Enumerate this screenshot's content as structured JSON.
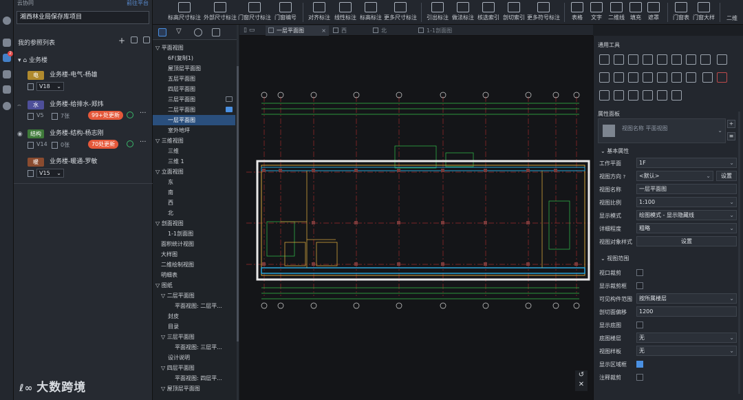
{
  "colors": {
    "accent": "#4a90e2",
    "update_badge": "#e5583a",
    "tag_elec": "#b08a2e",
    "tag_water": "#4e4f9a",
    "tag_struct": "#3f7a3a",
    "tag_hvac": "#8a4b2f"
  },
  "left": {
    "header": "云协同",
    "header_right": "前往平台",
    "project": "湘西林业局保存库项目",
    "section_title": "我的参照列表",
    "tree_root": "业务楼",
    "refs": [
      {
        "tag": "电",
        "name": "业务楼-电气-杨雄",
        "version": "V18",
        "count": "",
        "update": ""
      },
      {
        "tag": "水",
        "name": "业务楼-给排水-郑炜",
        "version": "V5",
        "count": "7张",
        "update": "99+处更新"
      },
      {
        "tag": "结构",
        "name": "业务楼-结构-杨志刚",
        "version": "V14",
        "count": "0张",
        "update": "70处更新"
      },
      {
        "tag": "暖",
        "name": "业务楼-暖通-罗敏",
        "version": "V15",
        "count": "",
        "update": ""
      }
    ],
    "watermark": "大数跨境"
  },
  "toolbar": {
    "items": [
      "标高尺寸标注",
      "外部尺寸标注",
      "门窗尺寸标注",
      "门窗编号",
      "对齐标注",
      "线性标注",
      "标高标注",
      "更多尺寸标注",
      "引出标注",
      "做法标注",
      "核选索引",
      "剖切索引",
      "更多符号标注",
      "表格",
      "文字",
      "二维线",
      "填充",
      "遮罩",
      "门窗表",
      "门窗大样",
      "二维"
    ]
  },
  "browser": {
    "items": [
      {
        "t": "▽ 平面视图",
        "lvl": 0
      },
      {
        "t": "6F(复制1)",
        "lvl": 2
      },
      {
        "t": "屋顶层平面图",
        "lvl": 2
      },
      {
        "t": "五层平面图",
        "lvl": 2
      },
      {
        "t": "四层平面图",
        "lvl": 2
      },
      {
        "t": "三层平面图",
        "lvl": 2
      },
      {
        "t": "二层平面图",
        "lvl": 2
      },
      {
        "t": "一层平面图",
        "lvl": 2
      },
      {
        "t": "室外地坪",
        "lvl": 2
      },
      {
        "t": "▽ 三维视图",
        "lvl": 0
      },
      {
        "t": "三维",
        "lvl": 2
      },
      {
        "t": "三维 1",
        "lvl": 2
      },
      {
        "t": "▽ 立面视图",
        "lvl": 0
      },
      {
        "t": "东",
        "lvl": 2
      },
      {
        "t": "南",
        "lvl": 2
      },
      {
        "t": "西",
        "lvl": 2
      },
      {
        "t": "北",
        "lvl": 2
      },
      {
        "t": "▽ 剖面视图",
        "lvl": 0
      },
      {
        "t": "1-1剖面图",
        "lvl": 2
      },
      {
        "t": "面积统计视图",
        "lvl": 1
      },
      {
        "t": "大样图",
        "lvl": 1
      },
      {
        "t": "二维绘制视图",
        "lvl": 1
      },
      {
        "t": "明细表",
        "lvl": 1
      },
      {
        "t": "▽ 图纸",
        "lvl": 0
      },
      {
        "t": "▽ 二层平面图",
        "lvl": 1
      },
      {
        "t": "平面视图: 二层平...",
        "lvl": 3
      },
      {
        "t": "封皮",
        "lvl": 2
      },
      {
        "t": "目录",
        "lvl": 2
      },
      {
        "t": "▽ 三层平面图",
        "lvl": 1
      },
      {
        "t": "平面视图: 三层平...",
        "lvl": 3
      },
      {
        "t": "设计说明",
        "lvl": 2
      },
      {
        "t": "▽ 四层平面图",
        "lvl": 1
      },
      {
        "t": "平面视图: 四层平...",
        "lvl": 3
      },
      {
        "t": "▽ 屋顶层平面图",
        "lvl": 1
      }
    ]
  },
  "doc_tabs": [
    "一层平面图",
    "西",
    "北",
    "1-1剖面图"
  ],
  "right": {
    "tools_title": "通用工具",
    "props_title": "属性面板",
    "props_box": "视图名称 平面视图",
    "basic": "基本属性",
    "range": "视图范围",
    "rows": {
      "work_plane": {
        "label": "工作平面",
        "value": "1F"
      },
      "view_dir": {
        "label": "视图方向",
        "value": "<默认>",
        "btn": "设置"
      },
      "view_name": {
        "label": "视图名称",
        "value": "一层平面图"
      },
      "scale": {
        "label": "视图比例",
        "value": "1:100"
      },
      "display_mode": {
        "label": "显示模式",
        "value": "绘图模式 - 显示隐藏线"
      },
      "detail": {
        "label": "详细程度",
        "value": "粗略"
      },
      "obj_style": {
        "label": "视图对象样式",
        "value": "设置"
      },
      "crop": {
        "label": "视口裁剪"
      },
      "crop_show": {
        "label": "显示裁剪框"
      },
      "visible_range": {
        "label": "可见构件范围",
        "value": "按所属楼层"
      },
      "cut_offset": {
        "label": "剖切面偏移",
        "value": "1200"
      },
      "show_under": {
        "label": "显示底图"
      },
      "base_floor": {
        "label": "底图楼层",
        "value": "无"
      },
      "view_template": {
        "label": "视图样板",
        "value": "无"
      },
      "show_region": {
        "label": "显示区域框"
      },
      "annot_crop": {
        "label": "注释裁剪"
      }
    }
  }
}
